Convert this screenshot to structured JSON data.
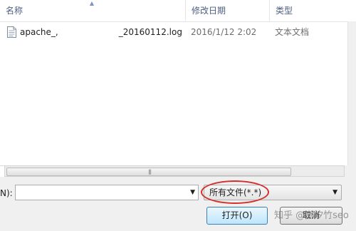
{
  "list": {
    "columns": {
      "name": "名称",
      "date": "修改日期",
      "type": "类型"
    },
    "sort_indicator": "▲",
    "rows": [
      {
        "name_prefix": "apache_",
        "name_sep": ",",
        "name_suffix": "_20160112.log",
        "date": "2016/1/12 2:02",
        "type": "文本文档",
        "icon": "text-document-icon"
      }
    ]
  },
  "hscroll": {
    "grip": "|||"
  },
  "footer": {
    "filename_label": "N):",
    "filename_value": "",
    "filetype_value": "所有文件(*.*)",
    "open_button": "打开(O)",
    "cancel_button": "取消",
    "watermark": "知乎 @潮汐竹seo"
  },
  "colors": {
    "highlight": "#d3302d",
    "header_text": "#4d6082"
  }
}
